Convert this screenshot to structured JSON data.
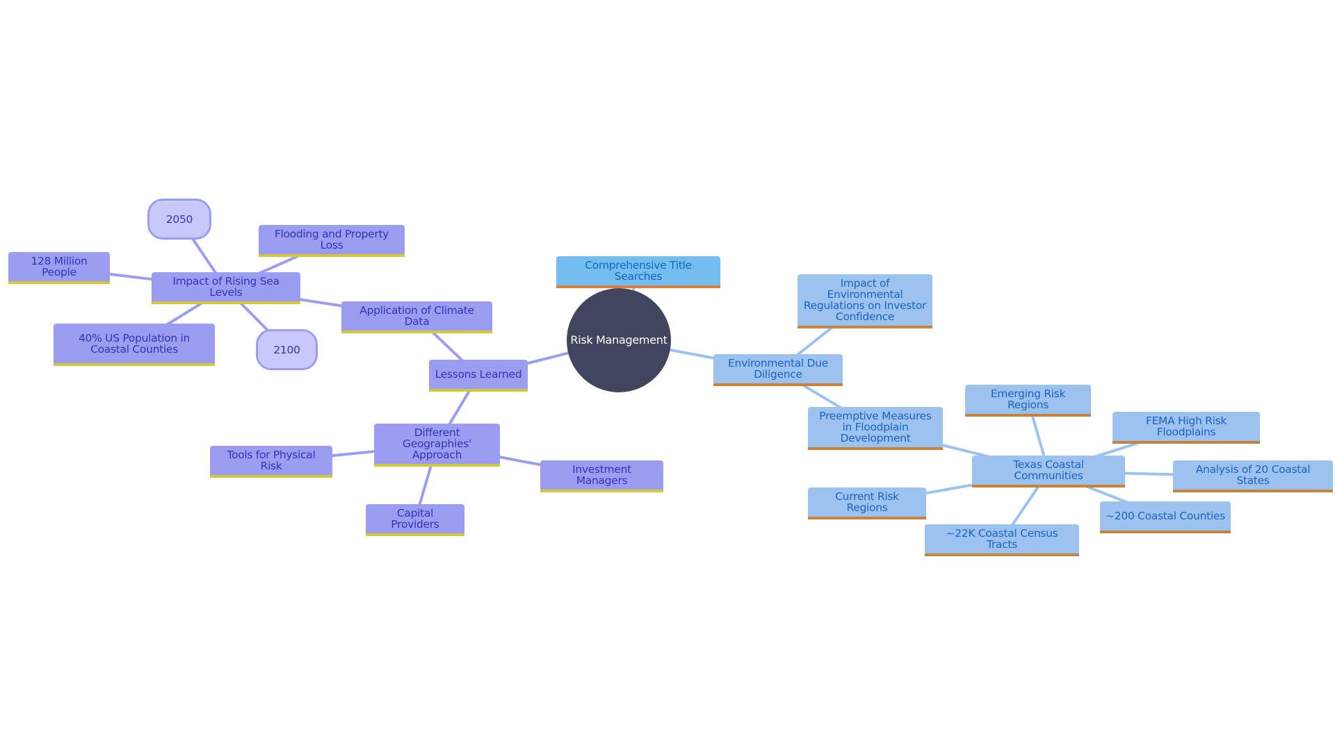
{
  "diagram": {
    "type": "mindmap",
    "colors": {
      "root_fill": "#41455E",
      "purple_fill": "#9B9EF0",
      "purple_text": "#3434B4",
      "purple_accent": "#D4C83A",
      "purple_edge": "#9B9EF0",
      "blue_fill": "#9CC2F0",
      "blue_text": "#1E63C0",
      "blue_accent": "#C8823C",
      "blue_edge": "#9CC2F0",
      "sky_fill": "#74BDF0",
      "pill_fill": "#C8C9FA"
    },
    "nodes": {
      "root": "Risk Management",
      "lessons": "Lessons Learned",
      "climate": "Application of Climate Data",
      "sealevel": "Impact of Rising Sea Levels",
      "flooding": "Flooding and Property Loss",
      "people": "128 Million People",
      "y2050": "2050",
      "y2100": "2100",
      "pop40": "40% US Population in Coastal Counties",
      "geo": "Different Geographies' Approach",
      "tools": "Tools for Physical Risk",
      "investment": "Investment Managers",
      "capital": "Capital Providers",
      "title": "Comprehensive Title Searches",
      "envdd": "Environmental Due Diligence",
      "regs": "Impact of Environmental Regulations on Investor Confidence",
      "preempt": "Preemptive Measures in Floodplain Development",
      "texas": "Texas Coastal Communities",
      "emerging": "Emerging Risk Regions",
      "fema": "FEMA High Risk Floodplains",
      "states20": "Analysis of 20 Coastal States",
      "counties200": "~200 Coastal Counties",
      "tracts22k": "~22K Coastal Census Tracts",
      "current": "Current Risk Regions"
    },
    "edges": [
      [
        "root",
        "lessons"
      ],
      [
        "lessons",
        "climate"
      ],
      [
        "climate",
        "sealevel"
      ],
      [
        "sealevel",
        "flooding"
      ],
      [
        "sealevel",
        "people"
      ],
      [
        "sealevel",
        "y2050"
      ],
      [
        "sealevel",
        "y2100"
      ],
      [
        "sealevel",
        "pop40"
      ],
      [
        "lessons",
        "geo"
      ],
      [
        "geo",
        "tools"
      ],
      [
        "geo",
        "investment"
      ],
      [
        "geo",
        "capital"
      ],
      [
        "root",
        "title"
      ],
      [
        "root",
        "envdd"
      ],
      [
        "envdd",
        "regs"
      ],
      [
        "envdd",
        "preempt"
      ],
      [
        "preempt",
        "texas"
      ],
      [
        "texas",
        "emerging"
      ],
      [
        "texas",
        "fema"
      ],
      [
        "texas",
        "states20"
      ],
      [
        "texas",
        "counties200"
      ],
      [
        "texas",
        "tracts22k"
      ],
      [
        "texas",
        "current"
      ]
    ]
  }
}
